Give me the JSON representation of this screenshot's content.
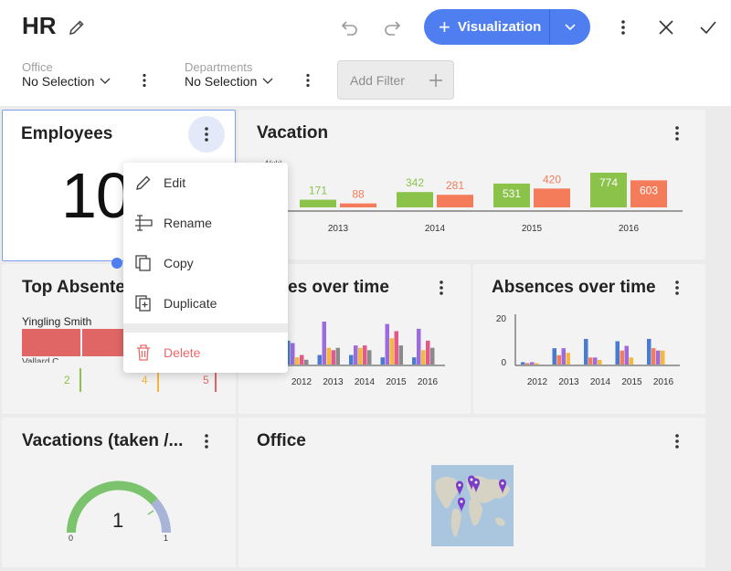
{
  "header": {
    "title": "HR",
    "visualization_label": "Visualization"
  },
  "filters": [
    {
      "label": "Office",
      "value": "No Selection"
    },
    {
      "label": "Departments",
      "value": "No Selection"
    }
  ],
  "add_filter_label": "Add Filter",
  "cards": {
    "employees": {
      "title": "Employees",
      "value": "10"
    },
    "vacation": {
      "title": "Vacation",
      "axis_fragment": "4(xk)"
    },
    "top_absences": {
      "title": "Top Absente",
      "row1_name": "Yingling Smith",
      "row2_name": "Vallard C",
      "values": [
        "2",
        "4",
        "5"
      ]
    },
    "absences_over_time_1": {
      "title": "es over time"
    },
    "absences_over_time_2": {
      "title": "Absences over time"
    },
    "vacations_gauge": {
      "title": "Vacations (taken /...",
      "value": "1",
      "min": "0",
      "max": "1"
    },
    "office": {
      "title": "Office"
    }
  },
  "context_menu": {
    "items": [
      {
        "label": "Edit",
        "icon": "pencil-icon"
      },
      {
        "label": "Rename",
        "icon": "rename-icon"
      },
      {
        "label": "Copy",
        "icon": "copy-icon"
      },
      {
        "label": "Duplicate",
        "icon": "duplicate-icon"
      },
      {
        "label": "Delete",
        "icon": "trash-icon"
      }
    ]
  },
  "colors": {
    "accent": "#4f7ef0",
    "green": "#8bc34a",
    "orange": "#f47c5a",
    "delete": "#e86a6a",
    "blue_bar": "#4a7bd0",
    "purple_bar": "#9c6cdc",
    "yellow_bar": "#f5b83c",
    "pink_bar": "#e25a8c",
    "gauge_green": "#7cc36e",
    "gauge_grey": "#a7b4d8"
  },
  "chart_data": [
    {
      "type": "bar",
      "title": "Vacation",
      "categories": [
        "2013",
        "2014",
        "2015",
        "2016"
      ],
      "series": [
        {
          "values": [
            171,
            342,
            531,
            774
          ]
        },
        {
          "values": [
            88,
            281,
            420,
            603
          ]
        }
      ]
    },
    {
      "type": "bar",
      "title": "es over time",
      "categories": [
        "2012",
        "2013",
        "2014",
        "2015",
        "2016"
      ],
      "series": [
        {
          "values": [
            10,
            4,
            4,
            3,
            3
          ]
        },
        {
          "values": [
            9,
            18,
            8,
            17,
            15
          ]
        },
        {
          "values": [
            3,
            7,
            7,
            11,
            6
          ]
        },
        {
          "values": [
            4,
            6,
            8,
            14,
            10
          ]
        },
        {
          "values": [
            2,
            7,
            6,
            8,
            7
          ]
        }
      ]
    },
    {
      "type": "bar",
      "title": "Absences over time",
      "categories": [
        "2012",
        "2013",
        "2014",
        "2015",
        "2016"
      ],
      "ylim": [
        0,
        20
      ],
      "yticks": [
        "20",
        "0"
      ],
      "series": [
        {
          "values": [
            1,
            7,
            11,
            10,
            11
          ]
        },
        {
          "values": [
            0,
            4,
            3,
            6,
            7
          ]
        },
        {
          "values": [
            1,
            7,
            3,
            8,
            6
          ]
        },
        {
          "values": [
            0,
            5,
            2,
            3,
            6
          ]
        }
      ]
    },
    {
      "type": "bar",
      "title": "Top Absente",
      "categories": [
        "Yingling Smith"
      ],
      "values": [
        5
      ],
      "xticks": [
        "2",
        "4",
        "5"
      ]
    }
  ]
}
